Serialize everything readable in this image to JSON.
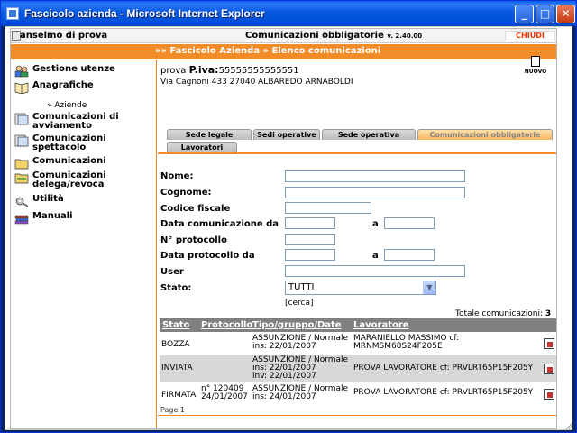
{
  "window": {
    "title": "Fascicolo azienda - Microsoft Internet Explorer",
    "min_glyph": "_",
    "max_glyph": "□",
    "close_glyph": "✕"
  },
  "header": {
    "user_name": "anselmo di prova",
    "page_title": "Comunicazioni obbligatorie",
    "version": "v. 2.40.00",
    "close_label": "CHIUDI"
  },
  "breadcrumb": "»» Fascicolo Azienda » Elenco comunicazioni",
  "sidebar": {
    "items": [
      {
        "label": "Gestione utenze",
        "icon": "users-icon"
      },
      {
        "label": "Anagrafiche",
        "icon": "book-icon"
      },
      {
        "label": "Comunicazioni di avviamento",
        "icon": "document-icon"
      },
      {
        "label": "Comunicazioni spettacolo",
        "icon": "document-icon"
      },
      {
        "label": "Comunicazioni",
        "icon": "folder-icon"
      },
      {
        "label": "Comunicazioni delega/revoca",
        "icon": "folder-icon"
      },
      {
        "label": "Utilità",
        "icon": "tools-icon"
      },
      {
        "label": "Manuali",
        "icon": "books-icon"
      }
    ],
    "sub_items": [
      "» Aziende"
    ]
  },
  "company": {
    "name": "prova",
    "piva_label": "P.iva:",
    "piva": "55555555555551",
    "address": "Via Cagnoni 433 27040 ALBAREDO ARNABOLDI",
    "new_label": "NUOVO"
  },
  "tabs": [
    {
      "label": "Sede legale",
      "active": false
    },
    {
      "label": "Sedi operative",
      "active": false
    },
    {
      "label": "Sede operativa",
      "active": false
    },
    {
      "label": "Comunicazioni obbligatorie",
      "active": true
    },
    {
      "label": "Lavoratori",
      "active": false
    }
  ],
  "form": {
    "nome_label": "Nome:",
    "nome_value": "",
    "cognome_label": "Cognome:",
    "cognome_value": "",
    "codice_fiscale_label": "Codice fiscale",
    "codice_fiscale_value": "",
    "data_com_label": "Data comunicazione da",
    "data_com_da": "",
    "a_label": "a",
    "data_com_a": "",
    "protocollo_label": "N° protocollo",
    "protocollo_value": "",
    "data_prot_label": "Data protocollo da",
    "data_prot_da": "",
    "a2_label": "a",
    "data_prot_a": "",
    "user_label": "User",
    "user_value": "",
    "stato_label": "Stato:",
    "stato_value": "TUTTI",
    "search_label": "[cerca]"
  },
  "results": {
    "total_label": "Totale comunicazioni:",
    "total": "3",
    "columns": [
      "Stato",
      "Protocollo",
      "Tipo/gruppo/Date",
      "Lavoratore"
    ],
    "rows": [
      {
        "stato": "BOZZA",
        "protocollo": "",
        "tipo1": "ASSUNZIONE / Normale",
        "tipo2": "ins: 22/01/2007",
        "tipo3": "",
        "lav1": "MARANIELLO MASSIMO cf:",
        "lav2": "MRNMSM68S24F205E"
      },
      {
        "stato": "INVIATA",
        "protocollo": "",
        "tipo1": "ASSUNZIONE / Normale",
        "tipo2": "ins: 22/01/2007",
        "tipo3": "inv: 22/01/2007",
        "lav1": "PROVA LAVORATORE cf: PRVLRT65P15F205Y",
        "lav2": ""
      },
      {
        "stato": "FIRMATA",
        "protocollo": "n° 120409",
        "protocollo2": "24/01/2007",
        "tipo1": "ASSUNZIONE / Normale",
        "tipo2": "ins: 24/01/2007",
        "tipo3": "",
        "lav1": "PROVA LAVORATORE cf: PRVLRT65P15F205Y",
        "lav2": ""
      }
    ],
    "page_label": "Page 1"
  }
}
